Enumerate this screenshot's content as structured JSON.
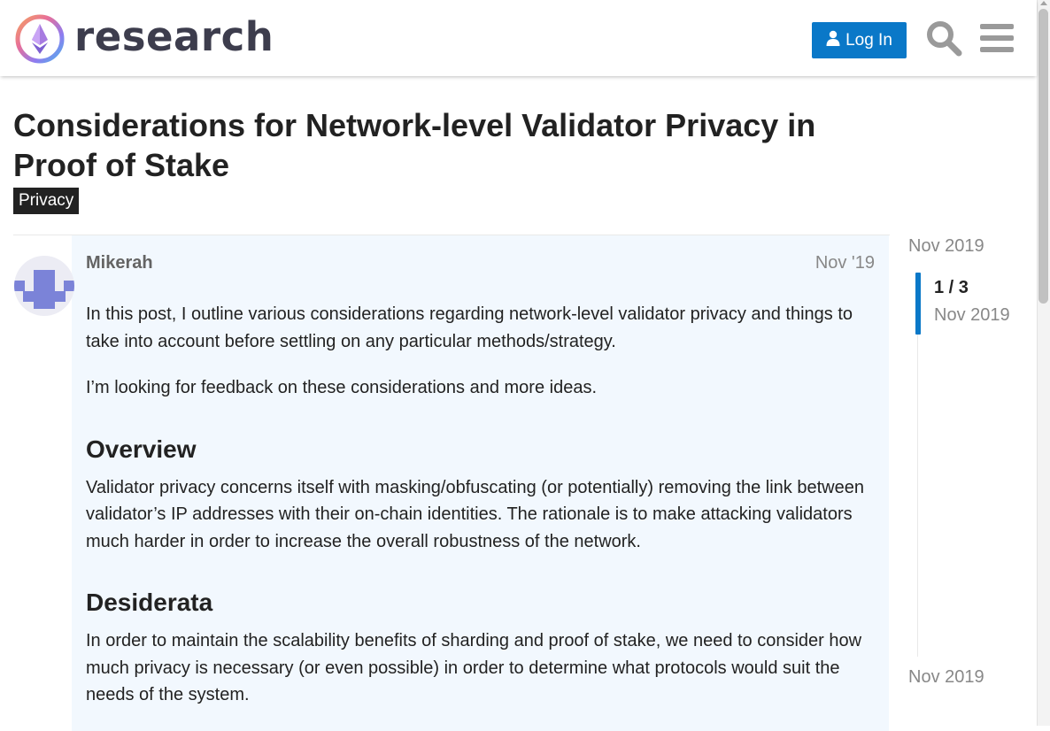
{
  "header": {
    "logo_text": "research",
    "login_label": "Log In",
    "icons": {
      "logo": "ethereum-logo-icon",
      "user": "user-icon",
      "search": "search-icon",
      "menu": "hamburger-menu-icon"
    },
    "accent_color": "#0a78c8"
  },
  "topic": {
    "title": "Considerations for Network-level Validator Privacy in Proof of Stake",
    "category": "Privacy",
    "category_color": "#222222"
  },
  "post": {
    "username": "Mikerah",
    "date": "Nov '19",
    "paragraphs": [
      "In this post, I outline various considerations regarding network-level validator privacy and things to take into account before settling on any particular methods/strategy.",
      "I’m looking for feedback on these considerations and more ideas."
    ],
    "sections": [
      {
        "heading": "Overview",
        "text": "Validator privacy concerns itself with masking/obfuscating (or potentially) removing the link between validator’s IP addresses with their on-chain identities. The rationale is to make attacking validators much harder in order to increase the overall robustness of the network."
      },
      {
        "heading": "Desiderata",
        "text": "In order to maintain the scalability benefits of sharding and proof of stake, we need to consider how much privacy is necessary (or even possible) in order to determine what protocols would suit the needs of the system."
      }
    ]
  },
  "timeline": {
    "start_date": "Nov 2019",
    "position": "1 / 3",
    "current_date": "Nov 2019",
    "end_date": "Nov 2019"
  }
}
